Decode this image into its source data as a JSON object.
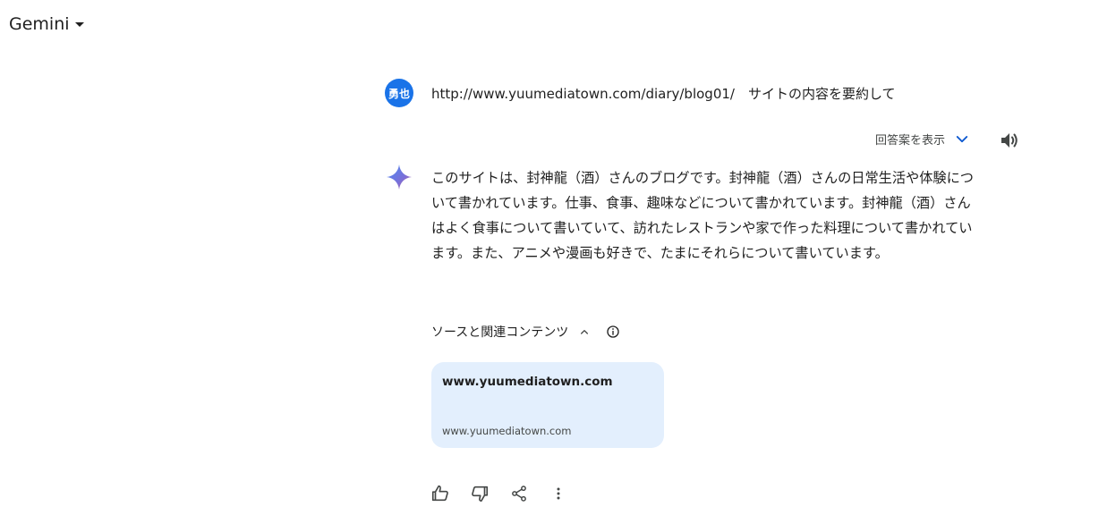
{
  "header": {
    "brand": "Gemini"
  },
  "user_message": {
    "avatar_initials": "勇也",
    "avatar_color": "#1a73e8",
    "text": "http://www.yuumediatown.com/diary/blog01/　サイトの内容を要約して"
  },
  "response_toolbar": {
    "show_drafts_label": "回答案を表示"
  },
  "response": {
    "text": "このサイトは、封神龍（酒）さんのブログです。封神龍（酒）さんの日常生活や体験について書かれています。仕事、食事、趣味などについて書かれています。封神龍（酒）さんはよく食事について書いていて、訪れたレストランや家で作った料理について書かれています。また、アニメや漫画も好きで、たまにそれらについて書いています。"
  },
  "sources": {
    "label": "ソースと関連コンテンツ",
    "cards": [
      {
        "title": "www.yuumediatown.com",
        "url": "www.yuumediatown.com"
      }
    ]
  },
  "colors": {
    "accent": "#0b57d0",
    "card_bg": "#e3effd"
  }
}
